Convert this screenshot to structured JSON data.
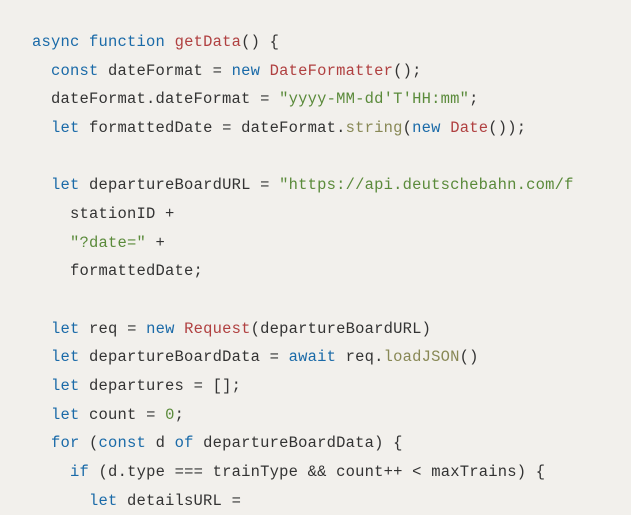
{
  "code": {
    "l01_async": "async",
    "l01_function": "function",
    "l01_name": "getData",
    "l01_paren": "()",
    "l01_brace": " {",
    "l02_const": "const",
    "l02_var": "dateFormat",
    "l02_eq": " = ",
    "l02_new": "new",
    "l02_cls": "DateFormatter",
    "l02_tail": "();",
    "l03_obj": "dateFormat",
    "l03_dot": ".",
    "l03_prop": "dateFormat",
    "l03_eq": " = ",
    "l03_str": "\"yyyy-MM-dd'T'HH:mm\"",
    "l03_semi": ";",
    "l04_let": "let",
    "l04_var": "formattedDate",
    "l04_eq": " = ",
    "l04_obj": "dateFormat",
    "l04_dot": ".",
    "l04_meth": "string",
    "l04_open": "(",
    "l04_new": "new",
    "l04_cls": "Date",
    "l04_tail": "());",
    "l06_let": "let",
    "l06_var": "departureBoardURL",
    "l06_eq": " = ",
    "l06_str": "\"https://api.deutschebahn.com/f",
    "l07_var": "stationID",
    "l07_plus": " +",
    "l08_str": "\"?date=\"",
    "l08_plus": " +",
    "l09_var": "formattedDate",
    "l09_semi": ";",
    "l11_let": "let",
    "l11_var": "req",
    "l11_eq": " = ",
    "l11_new": "new",
    "l11_cls": "Request",
    "l11_open": "(",
    "l11_arg": "departureBoardURL",
    "l11_close": ")",
    "l12_let": "let",
    "l12_var": "departureBoardData",
    "l12_eq": " = ",
    "l12_await": "await",
    "l12_obj": "req",
    "l12_dot": ".",
    "l12_meth": "loadJSON",
    "l12_tail": "()",
    "l13_let": "let",
    "l13_var": "departures",
    "l13_eq": " = ",
    "l13_val": "[];",
    "l14_let": "let",
    "l14_var": "count",
    "l14_eq": " = ",
    "l14_num": "0",
    "l14_semi": ";",
    "l15_for": "for",
    "l15_open": " (",
    "l15_const": "const",
    "l15_d": "d",
    "l15_of": "of",
    "l15_iter": "departureBoardData",
    "l15_close": ") {",
    "l16_if": "if",
    "l16_open": " (",
    "l16_d": "d",
    "l16_dot": ".",
    "l16_prop": "type",
    "l16_eqeq": " === ",
    "l16_tt": "trainType",
    "l16_and": " && ",
    "l16_count": "count",
    "l16_pp": "++",
    "l16_lt": " < ",
    "l16_max": "maxTrains",
    "l16_close": ") {",
    "l17_let": "let",
    "l17_var": "detailsURL",
    "l17_eq": " ="
  }
}
